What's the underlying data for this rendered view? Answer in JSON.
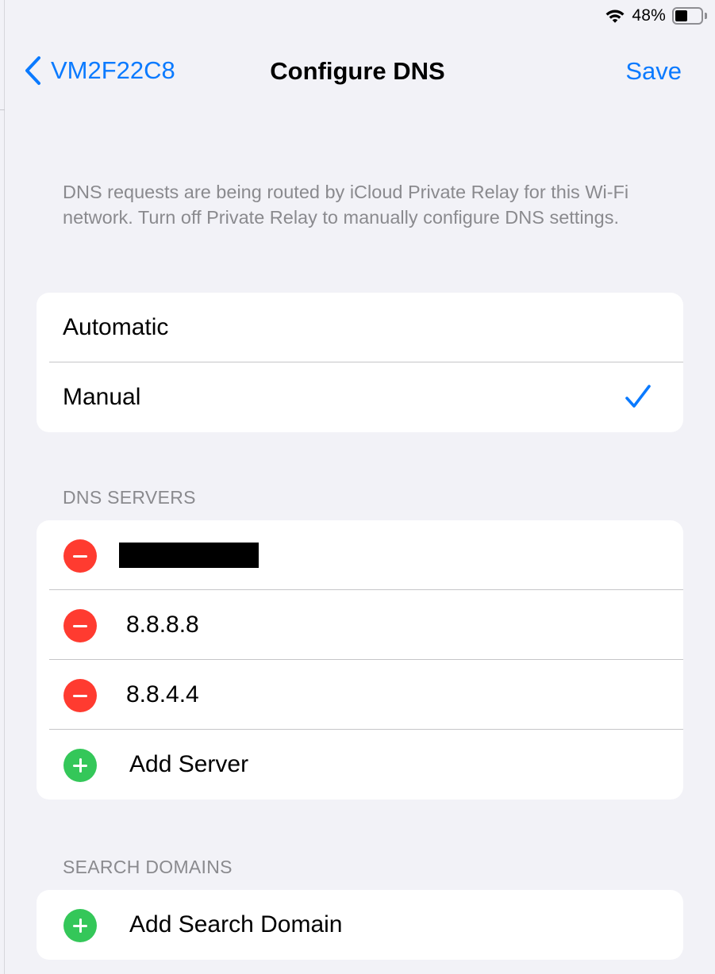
{
  "status_bar": {
    "battery_percent": "48%",
    "battery_level": 0.48,
    "icons": [
      "wifi-icon",
      "battery-icon"
    ]
  },
  "nav": {
    "back_label": "VM2F22C8",
    "title": "Configure DNS",
    "save_label": "Save"
  },
  "info_text": "DNS requests are being routed by iCloud Private Relay for this Wi-Fi network. Turn off Private Relay to manually configure DNS settings.",
  "dns_mode": {
    "options": [
      {
        "label": "Automatic",
        "selected": false
      },
      {
        "label": "Manual",
        "selected": true
      }
    ]
  },
  "dns_servers": {
    "header": "DNS SERVERS",
    "servers": [
      {
        "value": "",
        "redacted": true
      },
      {
        "value": "8.8.8.8",
        "redacted": false
      },
      {
        "value": "8.8.4.4",
        "redacted": false
      }
    ],
    "add_label": "Add Server"
  },
  "search_domains": {
    "header": "SEARCH DOMAINS",
    "add_label": "Add Search Domain"
  },
  "colors": {
    "accent": "#0a7aff",
    "background": "#f2f2f7",
    "remove": "#ff3b30",
    "add": "#34c759",
    "secondary_text": "#8a8a8e"
  }
}
